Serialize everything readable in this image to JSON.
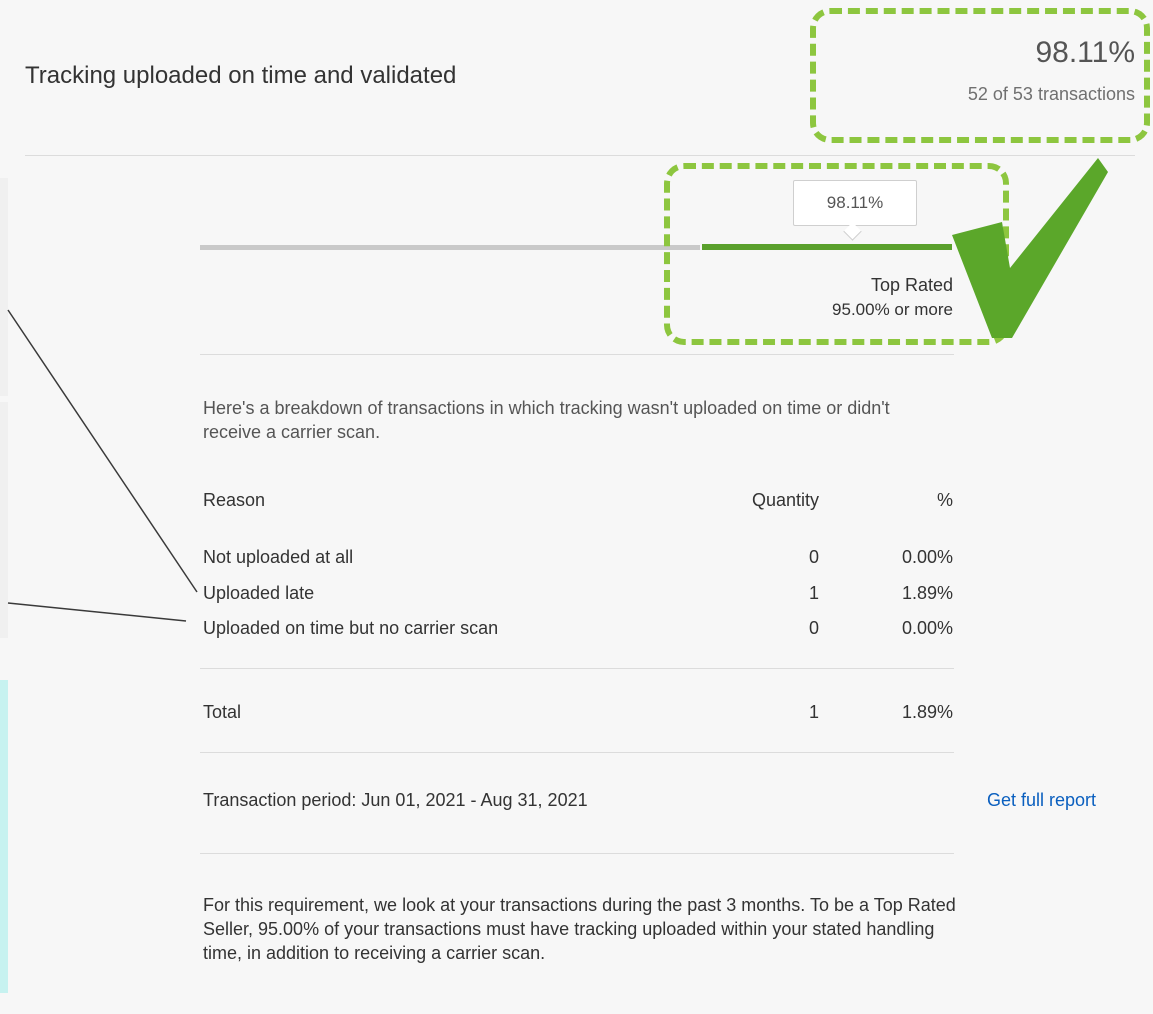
{
  "metric": {
    "title": "Tracking uploaded on time and validated",
    "score_percent": "98.11%",
    "score_detail": "52 of 53 transactions"
  },
  "progress": {
    "value_fraction": 0.9811,
    "tooltip": "98.11%",
    "tier_name": "Top Rated",
    "tier_threshold": "95.00% or more",
    "fill_color": "#5aa02c"
  },
  "breakdown": {
    "intro": "Here's a breakdown of transactions in which tracking wasn't uploaded on time or didn't receive a carrier scan.",
    "headers": {
      "reason": "Reason",
      "quantity": "Quantity",
      "percent": "%"
    },
    "rows": [
      {
        "reason": "Not uploaded at all",
        "quantity": "0",
        "percent": "0.00%"
      },
      {
        "reason": "Uploaded late",
        "quantity": "1",
        "percent": "1.89%"
      },
      {
        "reason": "Uploaded on time but no carrier scan",
        "quantity": "0",
        "percent": "0.00%"
      }
    ],
    "total": {
      "label": "Total",
      "quantity": "1",
      "percent": "1.89%"
    }
  },
  "period": {
    "text": "Transaction period: Jun 01, 2021 - Aug 31, 2021",
    "link_label": "Get full report"
  },
  "footnote": "For this requirement, we look at your transactions during the past 3 months. To be a Top Rated Seller, 95.00% of your transactions must have tracking uploaded within your stated handling time, in addition to receiving a carrier scan.",
  "annotation_colors": {
    "dashed_box": "#8dc63f",
    "checkmark": "#5ba72a",
    "pointer_line": "#3a3a3a"
  },
  "icons": {
    "checkmark": "checkmark-icon"
  }
}
